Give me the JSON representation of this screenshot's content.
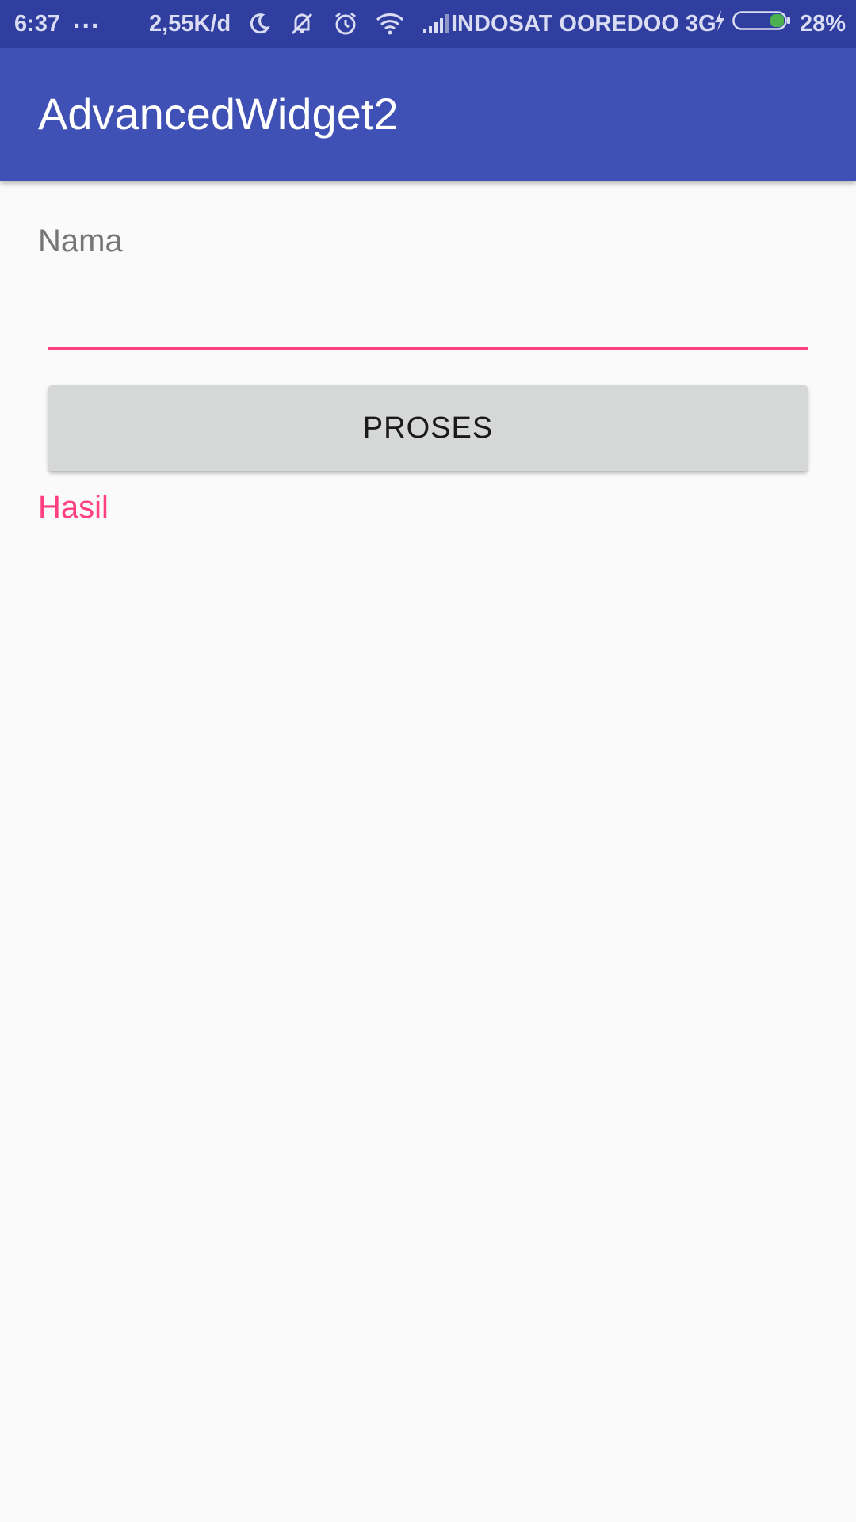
{
  "status_bar": {
    "time": "6:37",
    "dots": "...",
    "speed": "2,55K/d",
    "carrier": "INDOSAT OOREDOO 3G",
    "battery_percent": "28%",
    "battery_level": 0.28,
    "icons": [
      "moon-icon",
      "vibrate-off-icon",
      "alarm-icon",
      "wifi-icon",
      "signal-icon",
      "charging-icon",
      "battery-icon"
    ]
  },
  "app_bar": {
    "title": "AdvancedWidget2"
  },
  "form": {
    "name_label": "Nama",
    "name_value": "",
    "process_button": "PROSES",
    "result_label": "Hasil"
  },
  "colors": {
    "primary": "#3f51b5",
    "primary_dark": "#303f9f",
    "accent": "#ff4081",
    "background": "#fafafa",
    "button": "#d6d7d7"
  }
}
